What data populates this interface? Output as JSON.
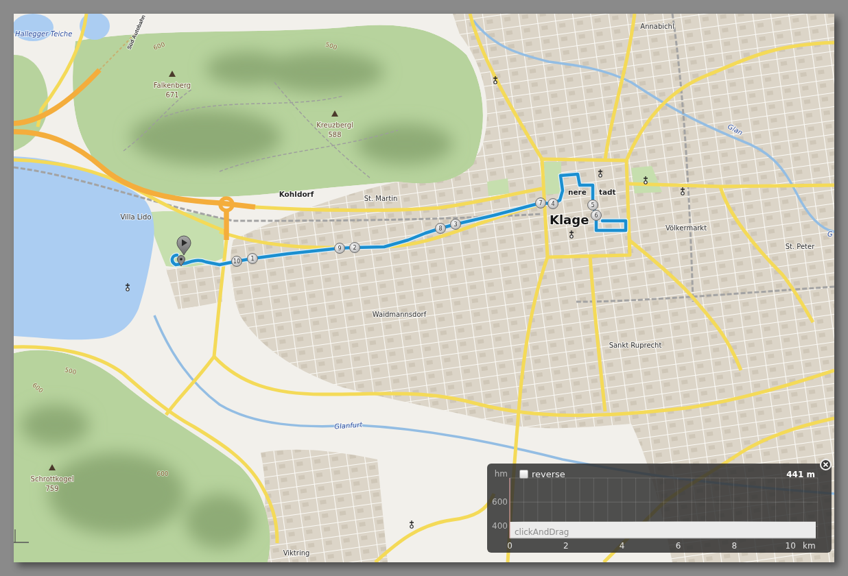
{
  "map": {
    "labels": [
      {
        "text": "Hallegger Teiche",
        "kind": "water"
      },
      {
        "text": "Süd Autobahn",
        "kind": "road"
      },
      {
        "text": "Annabichl",
        "kind": "suburb"
      },
      {
        "text": "Glan",
        "kind": "water"
      },
      {
        "text": "Kohldorf",
        "kind": "village"
      },
      {
        "text": "St. Martin",
        "kind": "suburb"
      },
      {
        "text": "nere",
        "kind": "district"
      },
      {
        "text": "tadt",
        "kind": "district"
      },
      {
        "text": "Villa Lido",
        "kind": "suburb"
      },
      {
        "text": "Klage",
        "kind": "city"
      },
      {
        "text": "Völkermarkt",
        "kind": "suburb"
      },
      {
        "text": "G",
        "kind": "water"
      },
      {
        "text": "St. Peter",
        "kind": "suburb"
      },
      {
        "text": "Waidmannsdorf",
        "kind": "suburb"
      },
      {
        "text": "Sankt Ruprecht",
        "kind": "suburb"
      },
      {
        "text": "Glanfurt",
        "kind": "water"
      },
      {
        "text": "Viktring",
        "kind": "suburb"
      }
    ],
    "peaks": [
      {
        "name": "Falkenberg",
        "elevation": "671"
      },
      {
        "name": "Kreuzbergl",
        "elevation": "588"
      },
      {
        "name": "Schrottkogel",
        "elevation": "759"
      }
    ],
    "contour_labels": [
      "600",
      "500",
      "500",
      "600",
      "600"
    ],
    "route_markers": [
      "10",
      "1",
      "9",
      "2",
      "8",
      "3",
      "7",
      "4",
      "5",
      "6"
    ]
  },
  "elevation_panel": {
    "reverse": {
      "label": "reverse",
      "checked": false
    },
    "readout": "441 m",
    "hint": "clickAndDrag",
    "chart_data": {
      "type": "area",
      "xlabel": "km",
      "ylabel": "hm",
      "x": [
        0,
        2,
        4,
        6,
        8,
        10,
        10.9
      ],
      "values": [
        437,
        438,
        438,
        439,
        439,
        438,
        438
      ],
      "xlim": [
        0,
        10.9
      ],
      "ylim": [
        300,
        800
      ],
      "xticks": [
        0,
        2,
        4,
        6,
        8,
        10
      ],
      "yticks": [
        400,
        600
      ],
      "grid": true
    }
  }
}
